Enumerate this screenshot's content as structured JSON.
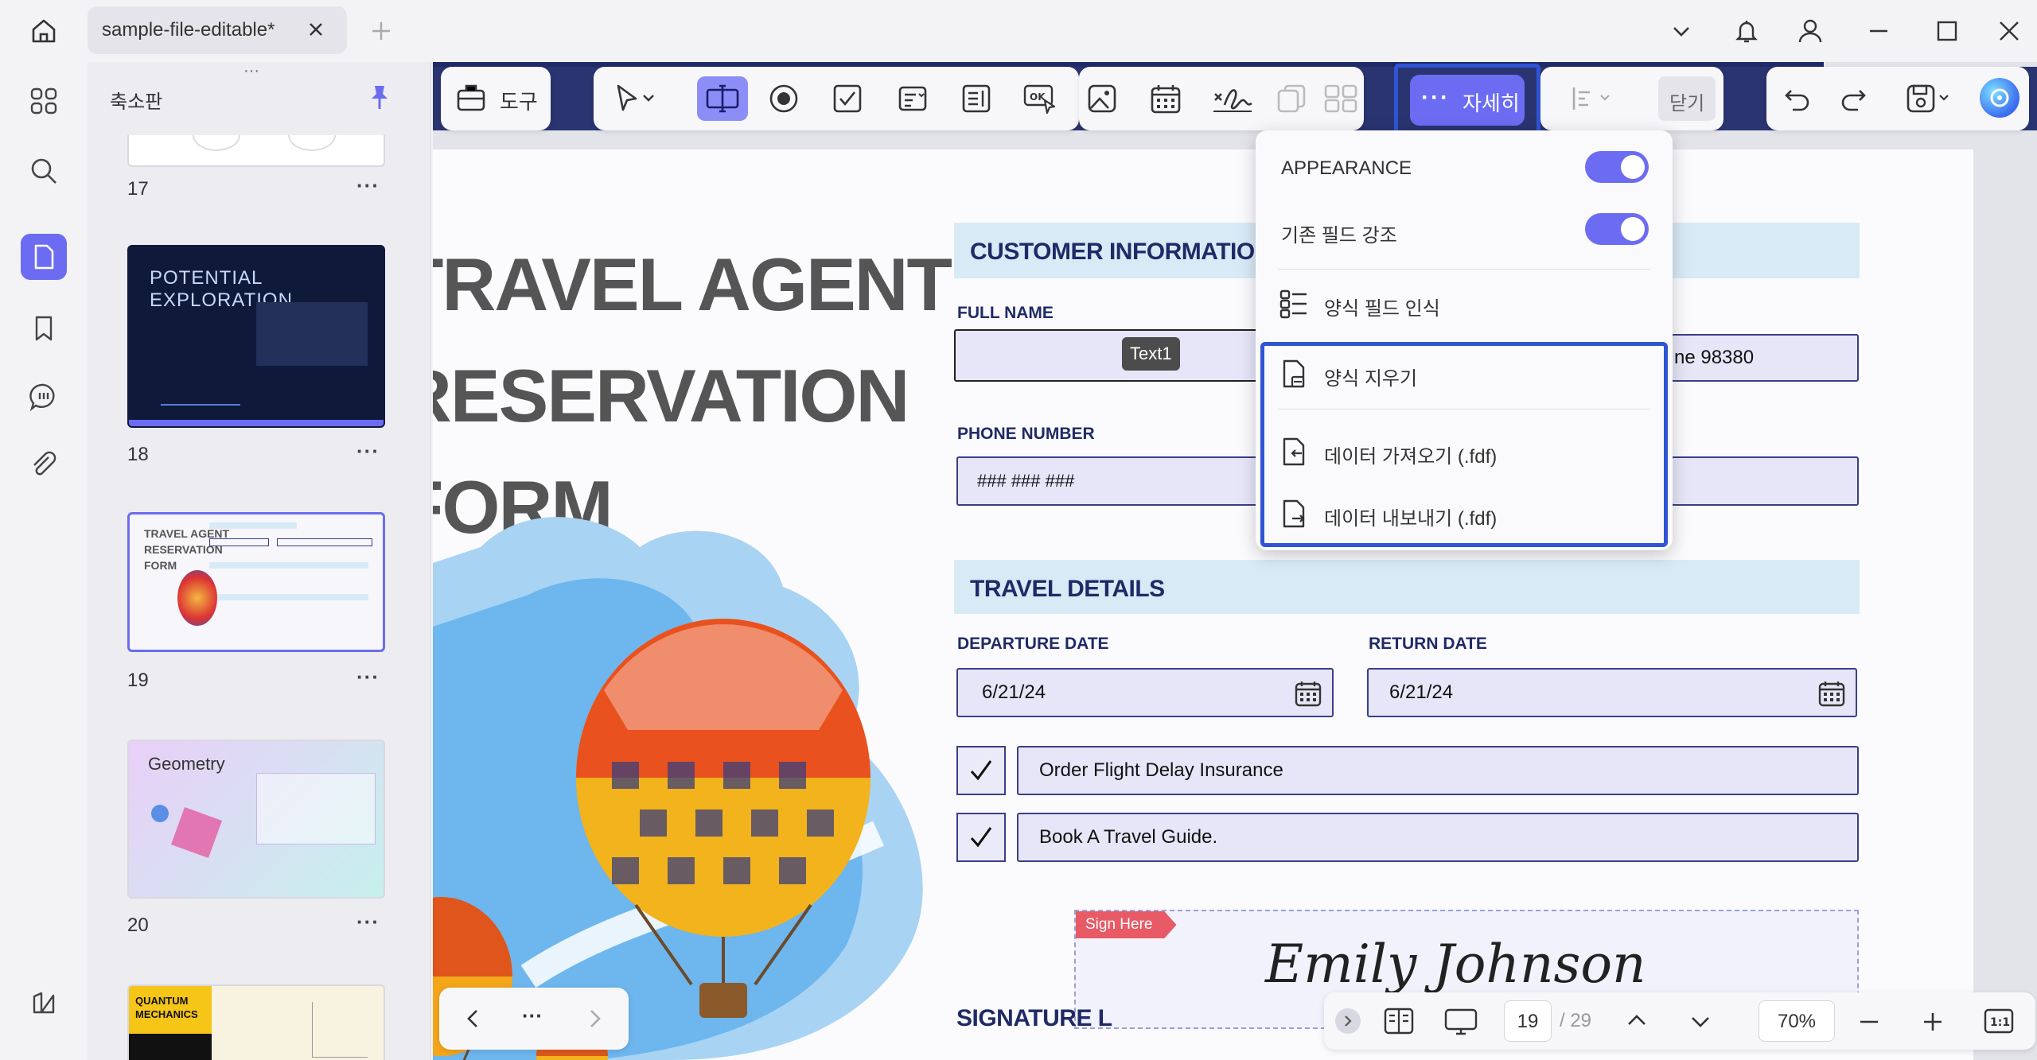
{
  "tab": {
    "title": "sample-file-editable*"
  },
  "panel": {
    "title": "축소판",
    "pages": [
      {
        "num": "17"
      },
      {
        "num": "18",
        "thumb_title": "POTENTIAL EXPLORATION"
      },
      {
        "num": "19",
        "thumb_title": "TRAVEL AGENT RESERVATION FORM"
      },
      {
        "num": "20",
        "thumb_title": "Geometry"
      },
      {
        "num": "",
        "thumb_title": "QUANTUM MECHANICS"
      }
    ],
    "more": "···"
  },
  "toolbar": {
    "tools_label": "도구",
    "more_label": "자세히",
    "close_label": "닫기"
  },
  "menu": {
    "appearance": "APPEARANCE",
    "highlight": "기존 필드 강조",
    "recognize": "양식 필드 인식",
    "clear": "양식 지우기",
    "import": "데이터 가져오기 (.fdf)",
    "export": "데이터 내보내기 (.fdf)"
  },
  "doc": {
    "title_lines": [
      "TRAVEL AGENT",
      "RESERVATION",
      "FORM"
    ],
    "customer_section": "CUSTOMER INFORMATION",
    "full_name_label": "FULL NAME",
    "full_name_tooltip": "Text1",
    "address_partial": "ne 98380",
    "phone_label": "PHONE NUMBER",
    "phone_value": "### ### ###",
    "travel_section": "TRAVEL DETAILS",
    "departure_label": "DEPARTURE DATE",
    "departure_value": "6/21/24",
    "return_label": "RETURN DATE",
    "return_value": "6/21/24",
    "option1": "Order Flight Delay Insurance",
    "option2": "Book A Travel Guide.",
    "sign_here": "Sign Here",
    "signature_text": "Emily Johnson",
    "signature_label": "SIGNATURE L"
  },
  "statusbar": {
    "current_page": "19",
    "total_pages": "/ 29",
    "zoom": "70%"
  },
  "colors": {
    "accent": "#6c6cf2",
    "highlight_outline": "#2f55d4",
    "form_navy": "#1f2a66",
    "section_bg": "#d9eaf7"
  }
}
